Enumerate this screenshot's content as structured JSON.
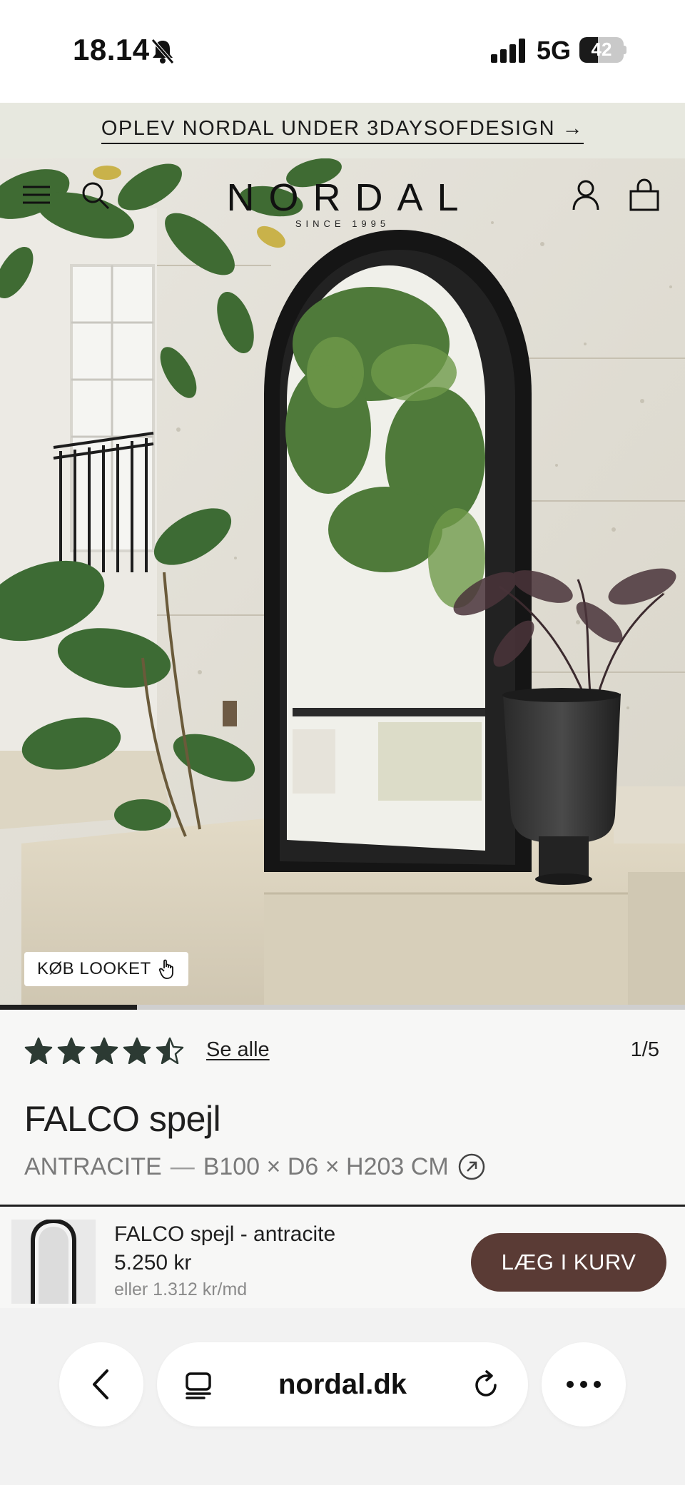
{
  "status_bar": {
    "time": "18.14",
    "network": "5G",
    "battery": "42",
    "battery_level": 0.42,
    "icons": [
      "bell-slash-icon",
      "signal-icon",
      "battery-icon"
    ]
  },
  "promo": {
    "text": "OPLEV NORDAL UNDER 3DAYSOFDESIGN →"
  },
  "header": {
    "brand": "NORDAL",
    "since": "SINCE 1995",
    "icons": [
      "menu-icon",
      "search-icon",
      "account-icon",
      "bag-icon"
    ]
  },
  "hero": {
    "shop_look_label": "KØB LOOKET",
    "gallery_progress": 0.2
  },
  "product": {
    "rating": 4.5,
    "rating_max": 5,
    "see_all_label": "Se alle",
    "pager": "1/5",
    "title": "FALCO spejl",
    "color": "ANTRACITE",
    "separator": "—",
    "dimensions": "B100 × D6 × H203 CM"
  },
  "sticky_cart": {
    "name": "FALCO spejl - antracite",
    "price": "5.250 kr",
    "monthly": "eller 1.312 kr/md",
    "button_label": "LÆG I KURV"
  },
  "browser": {
    "url": "nordal.dk",
    "icons": [
      "back-icon",
      "tabs-icon",
      "reload-icon",
      "more-icon"
    ]
  },
  "colors": {
    "promo_bg": "#e7e8df",
    "button": "#5a3b35",
    "stars": "#2c3a33"
  }
}
